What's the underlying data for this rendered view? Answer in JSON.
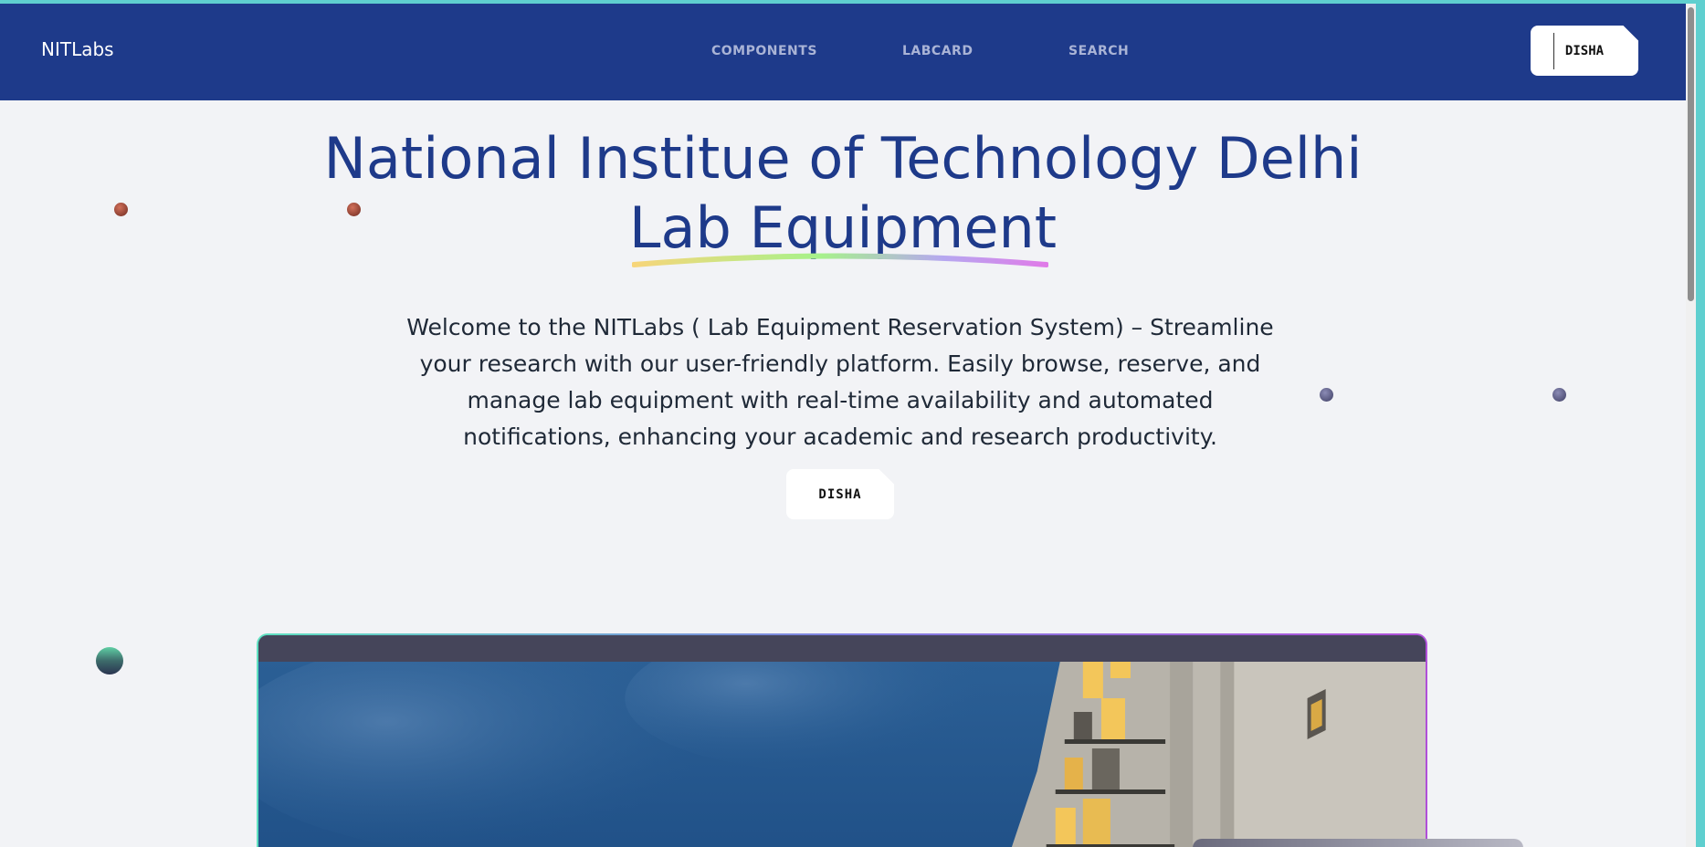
{
  "navbar": {
    "brand": "NITLabs",
    "links": [
      "COMPONENTS",
      "LABCARD",
      "SEARCH"
    ],
    "user_button": "DISHA"
  },
  "hero": {
    "title_line1": "National Institue of Technology Delhi",
    "title_line2": "Lab Equipment",
    "description": "Welcome to the NITLabs ( Lab Equipment Reservation System) – Streamline your research with our user-friendly platform. Easily browse, reserve, and manage lab equipment with real-time availability and automated notifications, enhancing your academic and research productivity.",
    "cta_button": "DISHA"
  },
  "colors": {
    "navbar_bg": "#1e3a8a",
    "title": "#1e3a8a",
    "page_bg": "#f2f3f6",
    "accent_teal": "#5fcfcf"
  }
}
